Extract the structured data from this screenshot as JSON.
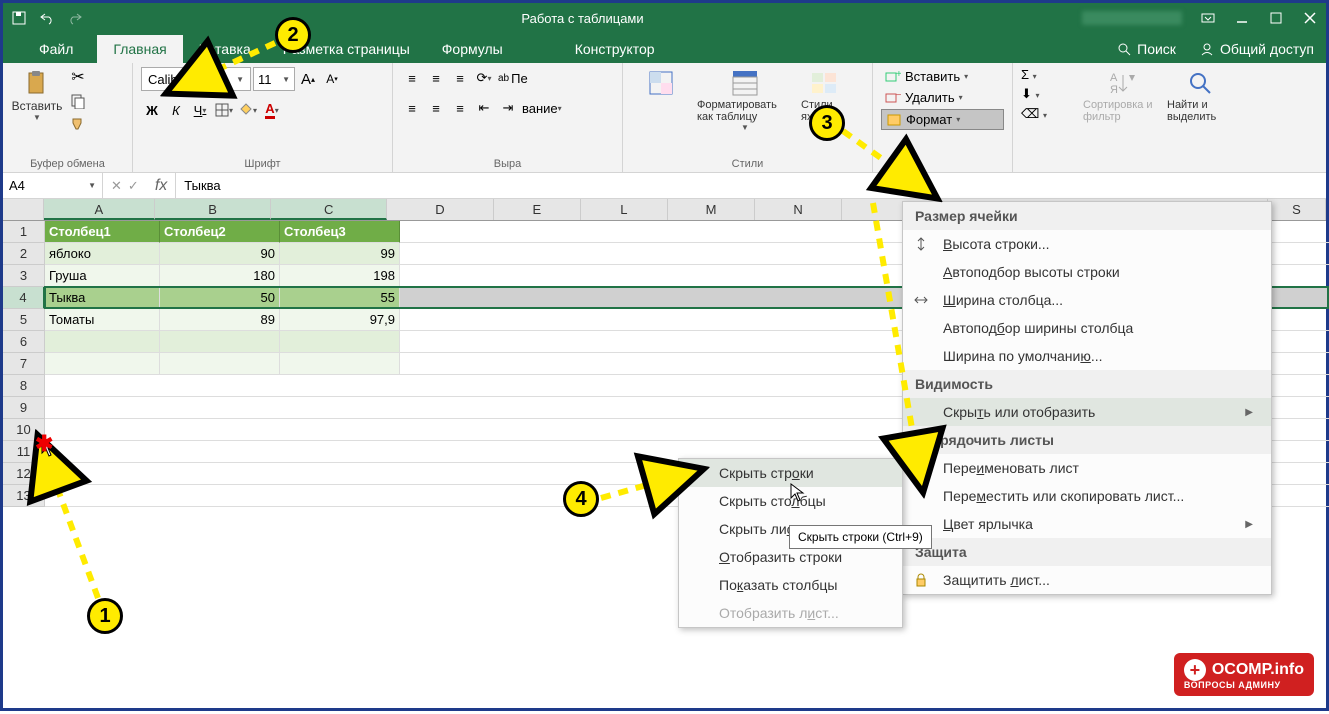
{
  "titlebar": {
    "center": "Работа с таблицами"
  },
  "tabs": {
    "file": "Файл",
    "home": "Главная",
    "insert": "Вставка",
    "layout": "Разметка страницы",
    "formulas": "Формулы",
    "design": "Конструктор",
    "search": "Поиск",
    "share": "Общий доступ"
  },
  "ribbon": {
    "clipboard": {
      "paste": "Вставить",
      "label": "Буфер обмена"
    },
    "font": {
      "name": "Calibri",
      "size": "11",
      "label": "Шрифт",
      "bold": "Ж",
      "italic": "К",
      "underline": "Ч"
    },
    "alignment": {
      "wrap": "Пе",
      "label": "Выра",
      "merge_partial": "вание"
    },
    "styles": {
      "format_table": "Форматировать как таблицу",
      "cell_styles": "Стили яхеек",
      "label": "Стили"
    },
    "cells": {
      "insert": "Вставить",
      "delete": "Удалить",
      "format": "Формат"
    },
    "editing": {
      "sort": "Сортировка и фильтр",
      "find": "Найти и выделить"
    }
  },
  "formula": {
    "ref": "A4",
    "value": "Тыква"
  },
  "grid": {
    "cols": [
      "A",
      "B",
      "C",
      "D",
      "E",
      "L",
      "M",
      "N",
      "S"
    ],
    "widths": [
      115,
      120,
      120,
      110,
      90,
      90,
      90,
      90,
      60
    ],
    "rows": [
      "1",
      "2",
      "3",
      "4",
      "5",
      "6",
      "7",
      "8",
      "9",
      "10",
      "11",
      "12",
      "13"
    ],
    "header": [
      "Столбец1",
      "Столбец2",
      "Столбец3"
    ],
    "data": [
      [
        "яблоко",
        "90",
        "99"
      ],
      [
        "Груша",
        "180",
        "198"
      ],
      [
        "Тыква",
        "50",
        "55"
      ],
      [
        "Томаты",
        "89",
        "97,9"
      ]
    ]
  },
  "format_menu": {
    "s1": "Размер ячейки",
    "row_height": "Высота строки...",
    "autofit_row": "Автоподбор высоты строки",
    "col_width": "Ширина столбца...",
    "autofit_col": "Автоподбор ширины столбца",
    "default_width": "Ширина по умолчанию...",
    "s2": "Видимость",
    "hide_show": "Скрыть или отобразить",
    "s3": "Упорядочить листы",
    "rename": "Переименовать лист",
    "move": "Переместить или скопировать лист...",
    "tab_color": "Цвет ярлычка",
    "s4": "Защита",
    "protect": "Защитить лист..."
  },
  "hide_menu": {
    "hide_rows": "Скрыть строки",
    "hide_cols": "Скрыть столбцы",
    "hide_sheet": "Скрыть лист",
    "show_rows": "Отобразить строки",
    "show_cols": "Показать столбцы",
    "show_sheet": "Отобразить лист..."
  },
  "tooltip": "Скрыть строки (Ctrl+9)",
  "steps": {
    "1": "1",
    "2": "2",
    "3": "3",
    "4": "4"
  },
  "watermark": {
    "main": "OCOMP.info",
    "sub": "ВОПРОСЫ АДМИНУ"
  }
}
